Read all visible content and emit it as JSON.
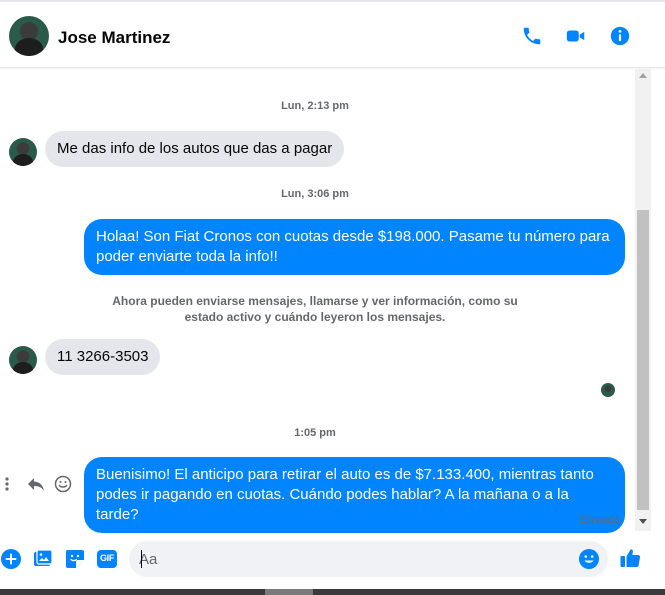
{
  "header": {
    "contact_name": "Jose Martinez",
    "icons": [
      "phone-icon",
      "video-camera-icon",
      "info-icon"
    ]
  },
  "colors": {
    "accent": "#0084ff",
    "incoming_bubble": "#e4e6eb",
    "muted_text": "#65676b"
  },
  "conversation": {
    "timestamp_1": "Lun, 2:13 pm",
    "msg_1": "Me das info de los autos que das a pagar",
    "timestamp_2": "Lun, 3:06 pm",
    "msg_2": "Holaa! Son Fiat Cronos con cuotas desde $198.000. Pasame tu número para poder enviarte toda la info!!",
    "system_notice": "Ahora pueden enviarse mensajes, llamarse y ver información, como su estado activo y cuándo leyeron los mensajes.",
    "msg_3": "11 3266-3503",
    "timestamp_3": "1:05 pm",
    "msg_4": "Buenisimo! El anticipo para retirar el auto es de $7.133.400, mientras tanto podes ir pagando en cuotas. Cuándo podes hablar? A la mañana o a la tarde?",
    "status": "Enviado"
  },
  "composer": {
    "placeholder": "Aa",
    "gif_label": "GIF",
    "icons": [
      "plus-icon",
      "photo-icon",
      "sticker-icon",
      "gif-icon",
      "emoji-icon",
      "like-icon"
    ]
  }
}
